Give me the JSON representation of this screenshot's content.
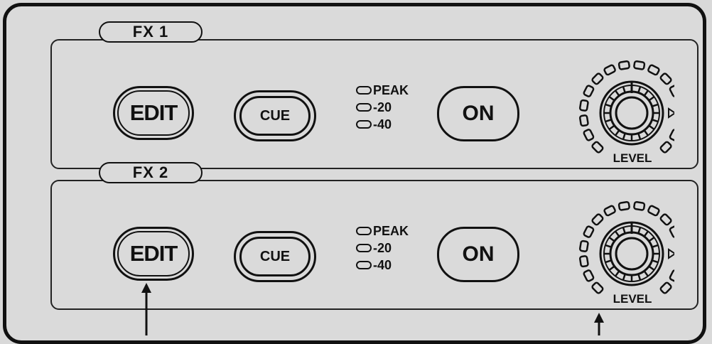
{
  "channels": [
    {
      "label": "FX 1",
      "edit": "EDIT",
      "cue": "CUE",
      "on": "ON",
      "meter": [
        "PEAK",
        "-20",
        "-40"
      ],
      "knob_label": "LEVEL"
    },
    {
      "label": "FX 2",
      "edit": "EDIT",
      "cue": "CUE",
      "on": "ON",
      "meter": [
        "PEAK",
        "-20",
        "-40"
      ],
      "knob_label": "LEVEL"
    }
  ],
  "colors": {
    "ink": "#111111",
    "panel": "#dadada",
    "background": "#d9d9d9"
  },
  "icons": [
    "level-knob-icon",
    "pointer-arrow-icon",
    "led-indicator-icon"
  ]
}
